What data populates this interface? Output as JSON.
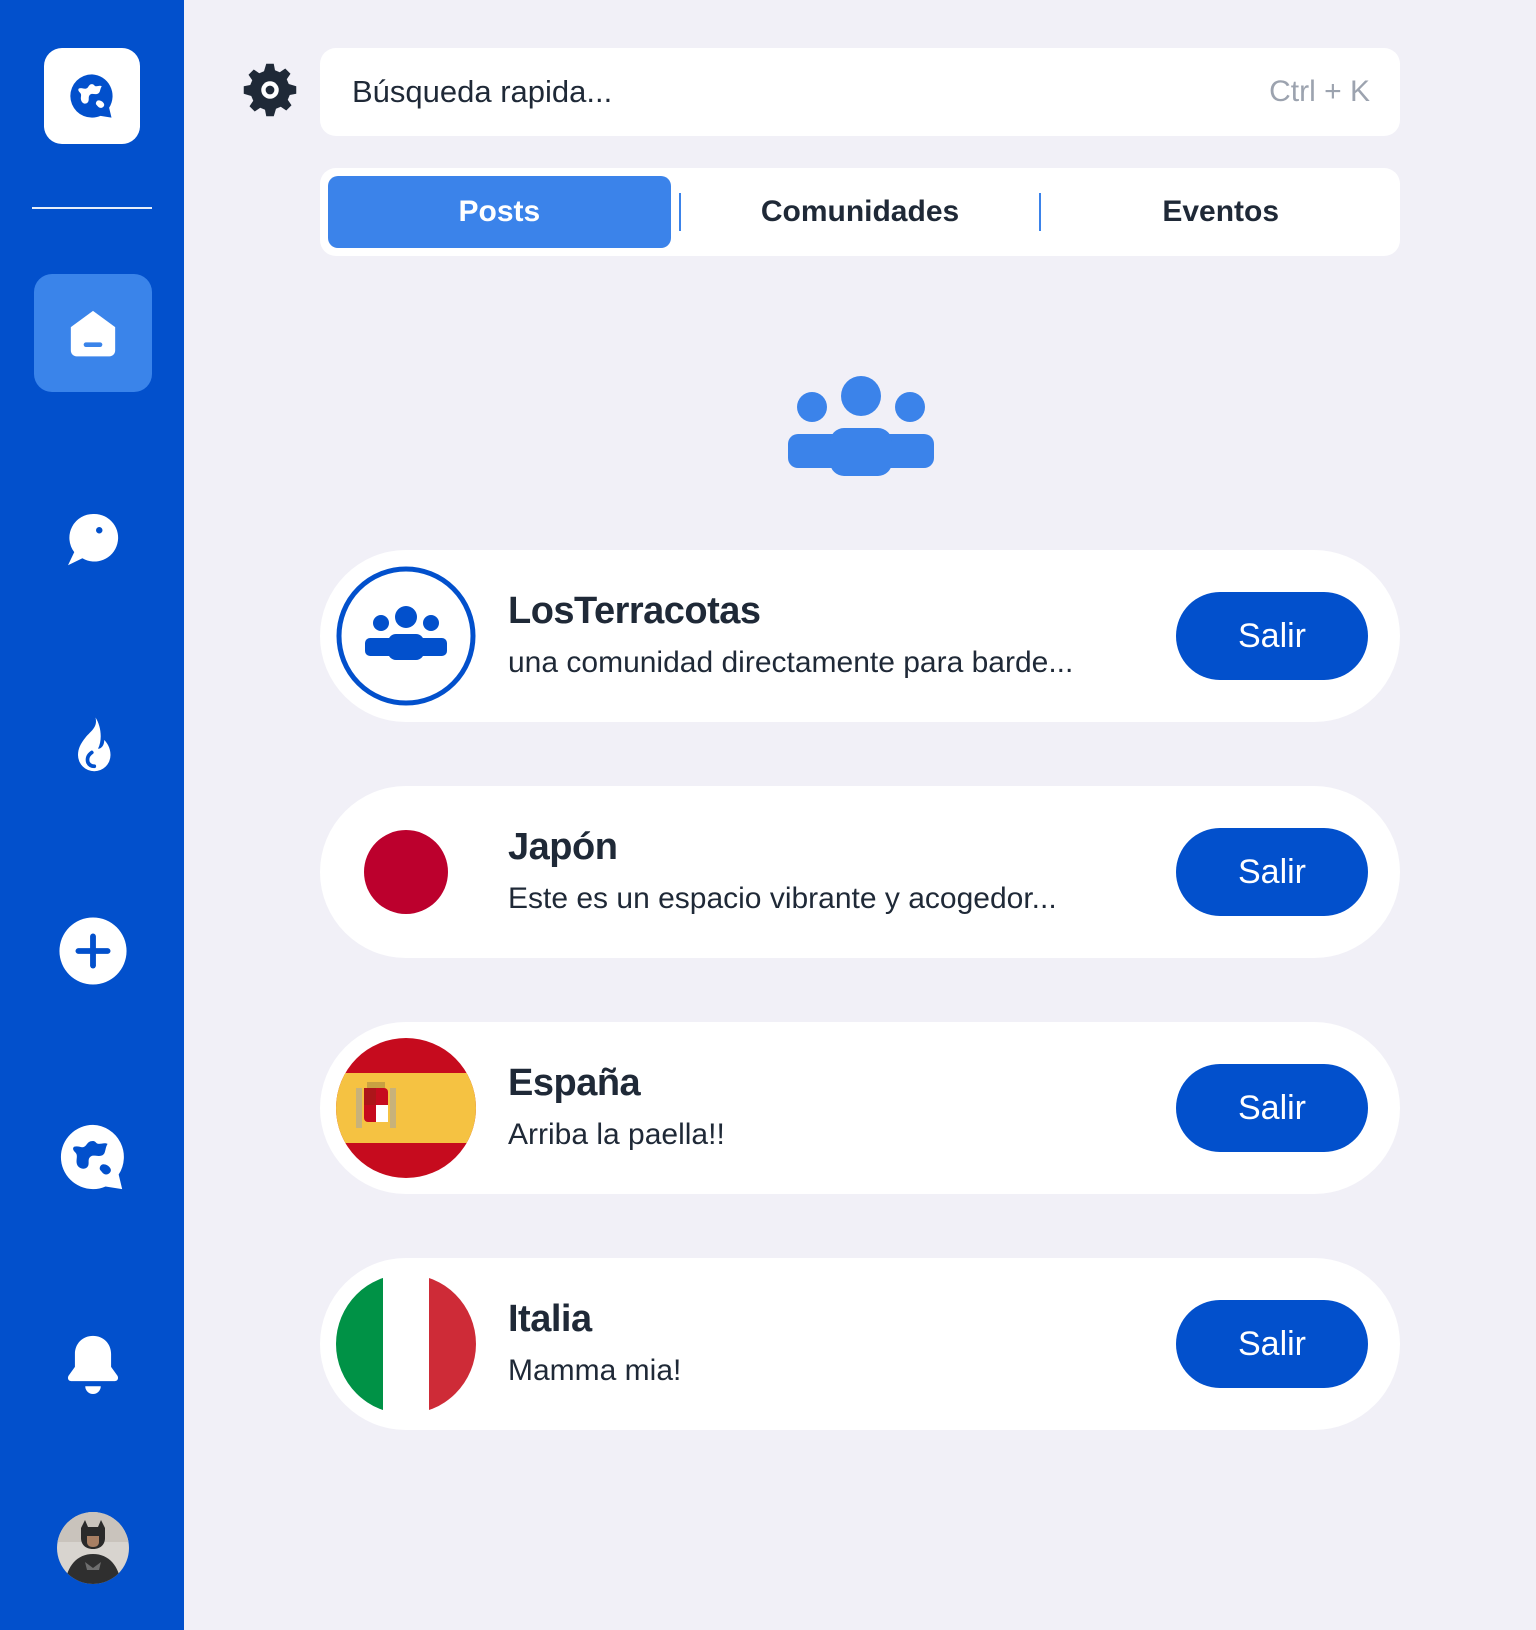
{
  "sidebar": {
    "logo_icon": "globe-chat-icon",
    "items": [
      {
        "name": "home",
        "icon": "home-icon",
        "active": true
      },
      {
        "name": "chat",
        "icon": "chat-bubble-icon",
        "active": false
      },
      {
        "name": "trending",
        "icon": "flame-icon",
        "active": false
      },
      {
        "name": "create",
        "icon": "plus-circle-icon",
        "active": false
      },
      {
        "name": "explore",
        "icon": "globe-chat-icon",
        "active": false
      },
      {
        "name": "notifications",
        "icon": "bell-icon",
        "active": false
      }
    ]
  },
  "search": {
    "placeholder": "Búsqueda rapida...",
    "shortcut": "Ctrl + K"
  },
  "tabs": [
    {
      "label": "Posts",
      "active": true
    },
    {
      "label": "Comunidades",
      "active": false
    },
    {
      "label": "Eventos",
      "active": false
    }
  ],
  "communities": [
    {
      "name": "LosTerracotas",
      "description": "una comunidad directamente para barde...",
      "image": "group-icon",
      "action": "Salir"
    },
    {
      "name": "Japón",
      "description": "Este es un espacio vibrante y acogedor...",
      "image": "japan-flag",
      "action": "Salir"
    },
    {
      "name": "España",
      "description": "Arriba la paella!!",
      "image": "spain-flag",
      "action": "Salir"
    },
    {
      "name": "Italia",
      "description": "Mamma mia!",
      "image": "italy-flag",
      "action": "Salir"
    }
  ],
  "colors": {
    "sidebar": "#0250cc",
    "accent": "#3b83ea",
    "background": "#f1f0f7",
    "button": "#0250cc",
    "text": "#1f2937"
  }
}
